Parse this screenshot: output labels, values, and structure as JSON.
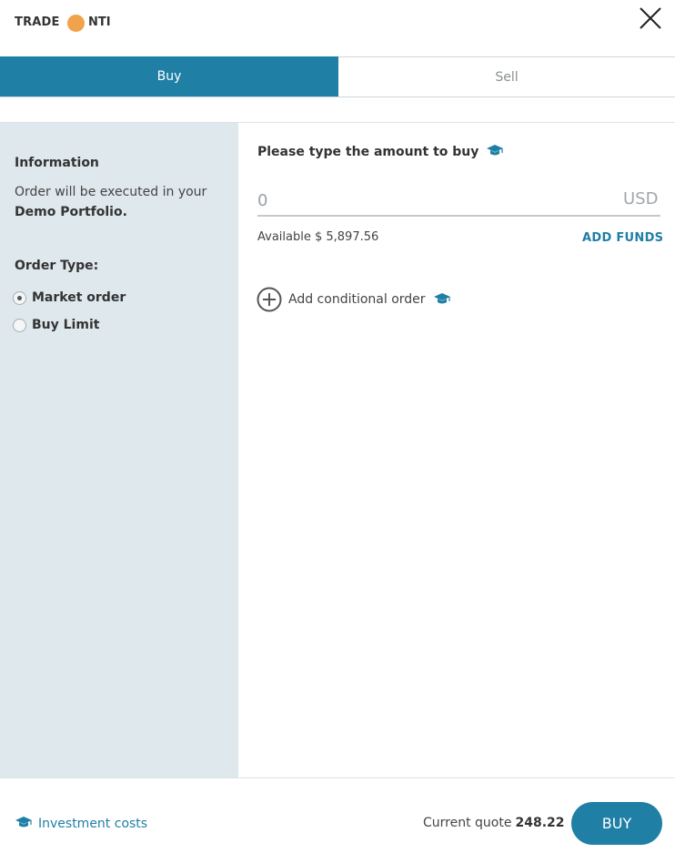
{
  "header": {
    "trade_label": "TRADE",
    "ticker": "NTI",
    "ticker_color": "#f0a34a"
  },
  "tabs": [
    {
      "label": "Buy",
      "active": true
    },
    {
      "label": "Sell",
      "active": false
    }
  ],
  "sidebar": {
    "info_title": "Information",
    "info_text": "Order will be executed in your",
    "info_portfolio": "Demo Portfolio.",
    "order_type_title": "Order Type:",
    "order_types": [
      {
        "label": "Market order",
        "checked": true
      },
      {
        "label": "Buy Limit",
        "checked": false
      }
    ]
  },
  "main": {
    "amount_title": "Please type the amount to buy",
    "amount_value": "0",
    "currency": "USD",
    "available": "Available $ 5,897.56",
    "add_funds": "ADD FUNDS",
    "conditional_label": "Add conditional order"
  },
  "footer": {
    "investment_costs": "Investment costs",
    "quote_label": "Current quote",
    "quote_value": "248.22",
    "buy_label": "BUY"
  },
  "colors": {
    "accent": "#1f7fa5",
    "sidebar_bg": "#dfe8ed"
  },
  "icons": {
    "close": "close-icon",
    "education": "graduation-cap-icon",
    "add": "plus-circle-icon"
  }
}
